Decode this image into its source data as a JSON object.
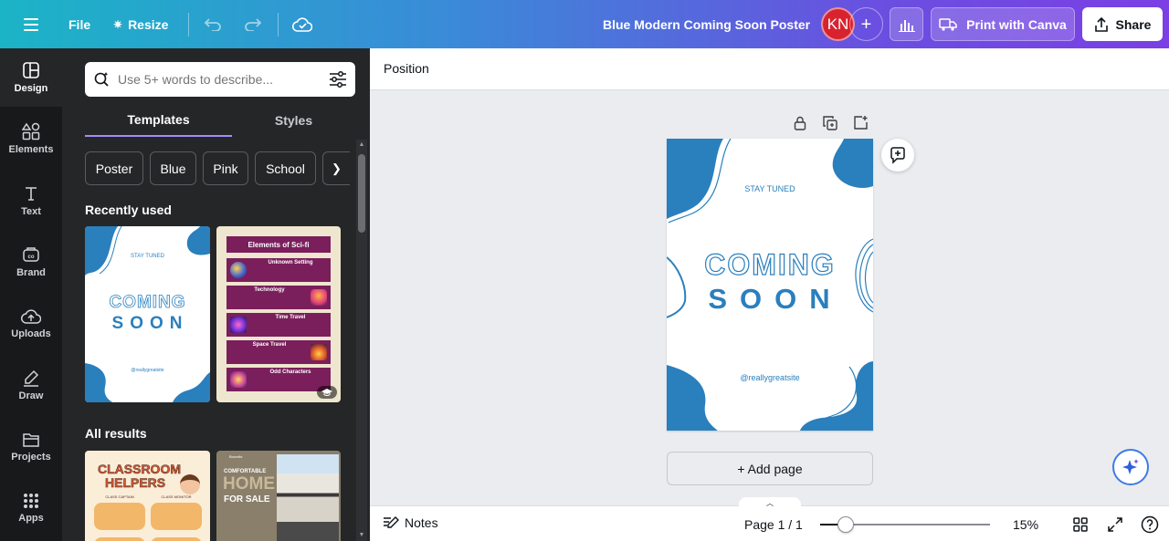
{
  "topbar": {
    "file_label": "File",
    "resize_label": "Resize",
    "doc_title": "Blue Modern Coming Soon Poster",
    "avatar_initials": "KN",
    "print_label": "Print with Canva",
    "share_label": "Share"
  },
  "rail": {
    "items": [
      {
        "label": "Design"
      },
      {
        "label": "Elements"
      },
      {
        "label": "Text"
      },
      {
        "label": "Brand"
      },
      {
        "label": "Uploads"
      },
      {
        "label": "Draw"
      },
      {
        "label": "Projects"
      },
      {
        "label": "Apps"
      }
    ]
  },
  "panel": {
    "search_placeholder": "Use 5+ words to describe...",
    "tabs": [
      {
        "label": "Templates"
      },
      {
        "label": "Styles"
      }
    ],
    "chips": [
      {
        "label": "Poster"
      },
      {
        "label": "Blue"
      },
      {
        "label": "Pink"
      },
      {
        "label": "School"
      }
    ],
    "recent_title": "Recently used",
    "all_title": "All results",
    "recent_1": {
      "stay": "STAY TUNED",
      "coming": "COMING",
      "soon": "SOON",
      "site": "@reallygreatsite"
    },
    "recent_2": {
      "title": "Elements of Sci-fi",
      "rows": [
        {
          "heading": "Unknown Setting"
        },
        {
          "heading": "Technology"
        },
        {
          "heading": "Time Travel"
        },
        {
          "heading": "Space Travel"
        },
        {
          "heading": "Odd Characters"
        }
      ]
    },
    "result_1": {
      "title_line1": "CLASSROOM",
      "title_line2": "HELPERS",
      "tag_1": "CLASS CAPTAIN",
      "tag_2": "CLASS MONITOR"
    },
    "result_2": {
      "brand": "Borcelle",
      "title_1": "COMFORTABLE",
      "title_2": "HOME",
      "title_3": "FOR SALE"
    }
  },
  "context": {
    "position_label": "Position"
  },
  "poster": {
    "stay": "STAY TUNED",
    "coming": "COMING",
    "soon": "SOON",
    "site": "@reallygreatsite"
  },
  "canvas": {
    "add_page_label": "+ Add page"
  },
  "footer": {
    "notes_label": "Notes",
    "page_label": "Page 1 / 1",
    "zoom_label": "15%",
    "zoom_value": 15
  },
  "colors": {
    "brand_blue": "#2a7fbd",
    "sci_purple": "#7a1f5c",
    "sci_bg": "#efe6cf"
  }
}
